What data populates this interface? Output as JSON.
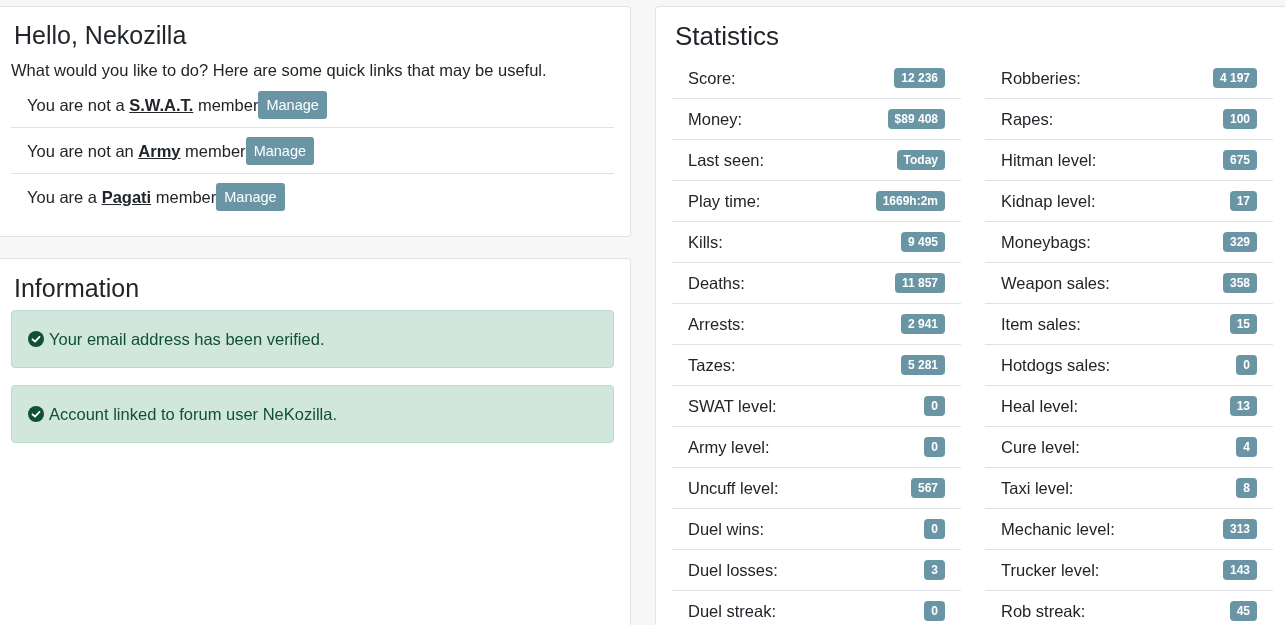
{
  "welcome": {
    "title": "Hello, Nekozilla",
    "intro": "What would you like to do? Here are some quick links that may be useful.",
    "memberships": [
      {
        "before": "You are not a",
        "group": "S.W.A.T.",
        "after": "member",
        "button": "Manage"
      },
      {
        "before": "You are not an",
        "group": "Army",
        "after": "member",
        "button": "Manage"
      },
      {
        "before": "You are a",
        "group": "Pagati",
        "after": "member",
        "button": "Manage"
      }
    ]
  },
  "information": {
    "title": "Information",
    "alerts": [
      {
        "text": "Your email address has been verified."
      },
      {
        "text": "Account linked to forum user NeKozilla."
      }
    ]
  },
  "statistics": {
    "title": "Statistics",
    "columns": [
      [
        {
          "label": "Score:",
          "value": "12 236"
        },
        {
          "label": "Money:",
          "value": "$89 408"
        },
        {
          "label": "Last seen:",
          "value": "Today"
        },
        {
          "label": "Play time:",
          "value": "1669h:2m"
        },
        {
          "label": "Kills:",
          "value": "9 495"
        },
        {
          "label": "Deaths:",
          "value": "11 857"
        },
        {
          "label": "Arrests:",
          "value": "2 941"
        },
        {
          "label": "Tazes:",
          "value": "5 281"
        },
        {
          "label": "SWAT level:",
          "value": "0"
        },
        {
          "label": "Army level:",
          "value": "0"
        },
        {
          "label": "Uncuff level:",
          "value": "567"
        },
        {
          "label": "Duel wins:",
          "value": "0"
        },
        {
          "label": "Duel losses:",
          "value": "3"
        },
        {
          "label": "Duel streak:",
          "value": "0"
        }
      ],
      [
        {
          "label": "Robberies:",
          "value": "4 197"
        },
        {
          "label": "Rapes:",
          "value": "100"
        },
        {
          "label": "Hitman level:",
          "value": "675"
        },
        {
          "label": "Kidnap level:",
          "value": "17"
        },
        {
          "label": "Moneybags:",
          "value": "329"
        },
        {
          "label": "Weapon sales:",
          "value": "358"
        },
        {
          "label": "Item sales:",
          "value": "15"
        },
        {
          "label": "Hotdogs sales:",
          "value": "0"
        },
        {
          "label": "Heal level:",
          "value": "13"
        },
        {
          "label": "Cure level:",
          "value": "4"
        },
        {
          "label": "Taxi level:",
          "value": "8"
        },
        {
          "label": "Mechanic level:",
          "value": "313"
        },
        {
          "label": "Trucker level:",
          "value": "143"
        },
        {
          "label": "Rob streak:",
          "value": "45"
        }
      ]
    ]
  }
}
